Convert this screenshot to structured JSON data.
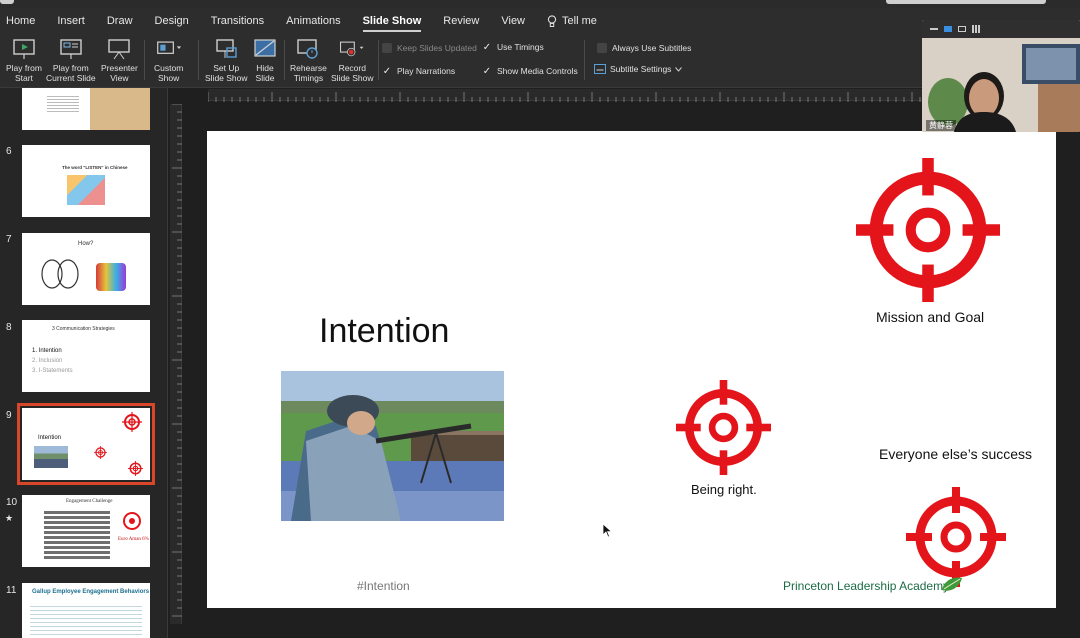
{
  "ribbon_tabs": [
    "Home",
    "Insert",
    "Draw",
    "Design",
    "Transitions",
    "Animations",
    "Slide Show",
    "Review",
    "View"
  ],
  "tell_me": "Tell me",
  "ribbon": {
    "play_from_start": [
      "Play from",
      "Start"
    ],
    "play_from_current": [
      "Play from",
      "Current Slide"
    ],
    "presenter_view": [
      "Presenter",
      "View"
    ],
    "custom_show": [
      "Custom",
      "Show"
    ],
    "set_up": [
      "Set Up",
      "Slide Show"
    ],
    "hide_slide": [
      "Hide",
      "Slide"
    ],
    "rehearse": [
      "Rehearse",
      "Timings"
    ],
    "record": [
      "Record",
      "Slide Show"
    ],
    "keep_slides_updated": "Keep Slides Updated",
    "use_timings": "Use Timings",
    "play_narrations": "Play Narrations",
    "show_media_controls": "Show Media Controls",
    "always_use_subtitles": "Always Use Subtitles",
    "subtitle_settings": "Subtitle Settings"
  },
  "thumbnails": {
    "numbers": [
      "6",
      "7",
      "8",
      "9",
      "10",
      "11"
    ],
    "s6_title": "The word \"LISTEN\" in Chinese",
    "s7_title": "How?",
    "s8_title": "3 Communication Strategies",
    "s8_items": [
      "1.  Intention",
      "2.  Inclusion",
      "3.  I-Statements"
    ],
    "s9_title": "Intention",
    "s10_title": "Engagement Challenge",
    "s10_note": "Euro Aman 6%",
    "s11_title": "Gallup Employee Engagement Behaviors"
  },
  "slide": {
    "title": "Intention",
    "label_mission": "Mission and Goal",
    "label_being_right": "Being right.",
    "label_everyone": "Everyone else’s success",
    "hashtag": "#Intention",
    "brand": "Princeton Leadership Academy"
  },
  "webcam": {
    "name": "黄静蓉"
  },
  "colors": {
    "target_red": "#e4141b",
    "selection": "#d9472b",
    "brand_green": "#1c6b45"
  }
}
